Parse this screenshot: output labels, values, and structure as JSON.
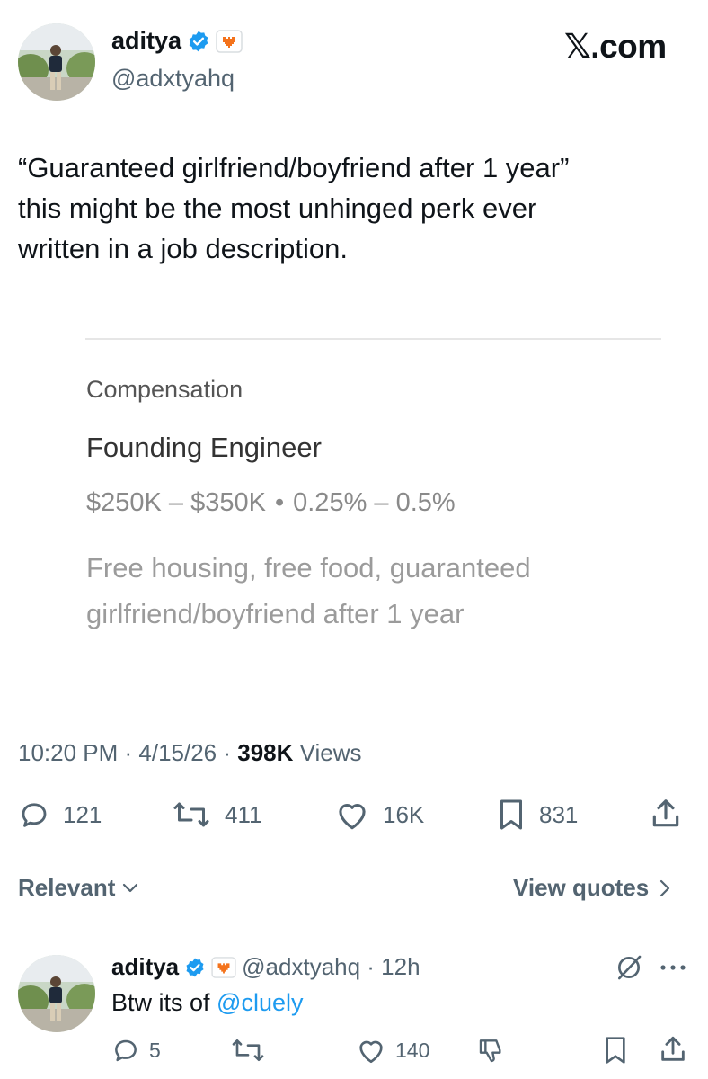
{
  "author": {
    "name": "aditya",
    "handle": "@adxtyahq",
    "verified_color": "#1d9bf0"
  },
  "brand": {
    "logo_text": "𝕏.com"
  },
  "tweet": {
    "lines": [
      "“Guaranteed girlfriend/boyfriend after 1 year”",
      "this might be the most unhinged perk ever",
      "written in a job description."
    ]
  },
  "job_card": {
    "section_label": "Compensation",
    "role": "Founding Engineer",
    "salary_range": "$250K – $350K",
    "bullet": "•",
    "equity_range": "0.25% – 0.5%",
    "perks_lines": [
      "Free housing, free food, guaranteed",
      "girlfriend/boyfriend after 1 year"
    ]
  },
  "meta": {
    "time": "10:20 PM · 4/15/26 · ",
    "views_count": "398K",
    "views_label": " Views"
  },
  "actions": {
    "replies": "121",
    "reposts": "411",
    "likes": "16K",
    "bookmarks": "831"
  },
  "sort": {
    "relevant_label": "Relevant",
    "view_quotes_label": "View quotes"
  },
  "reply": {
    "name": "aditya",
    "handle_time": "@adxtyahq · 12h",
    "text_prefix": "Btw its of ",
    "mention": "@cluely",
    "replies": "5",
    "likes": "140"
  },
  "colors": {
    "accent": "#1d9bf0",
    "badge_orange": "#f4731c",
    "muted": "#536471"
  }
}
